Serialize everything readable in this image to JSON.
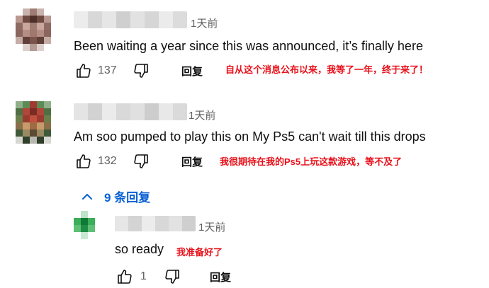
{
  "comments": [
    {
      "time": "1天前",
      "text": "Been waiting a year since this was announced, it’s finally here",
      "likes": "137",
      "reply_label": "回复",
      "note": "自从这个消息公布以来，我等了一年，终于来了！"
    },
    {
      "time": "1天前",
      "text": "Am soo pumped to play this on My Ps5 can't wait till this drops",
      "likes": "132",
      "reply_label": "回复",
      "note": "我很期待在我的Ps5上玩这款游戏，等不及了"
    }
  ],
  "replies_toggle": {
    "label": "9 条回复",
    "icon": "chevron-up-icon"
  },
  "reply": {
    "time": "1天前",
    "text": "so ready",
    "note": "我准备好了",
    "likes": "1",
    "reply_label": "回复"
  },
  "colors": {
    "link_blue": "#065fd4",
    "note_red": "#e8101a",
    "meta_gray": "#606060"
  }
}
